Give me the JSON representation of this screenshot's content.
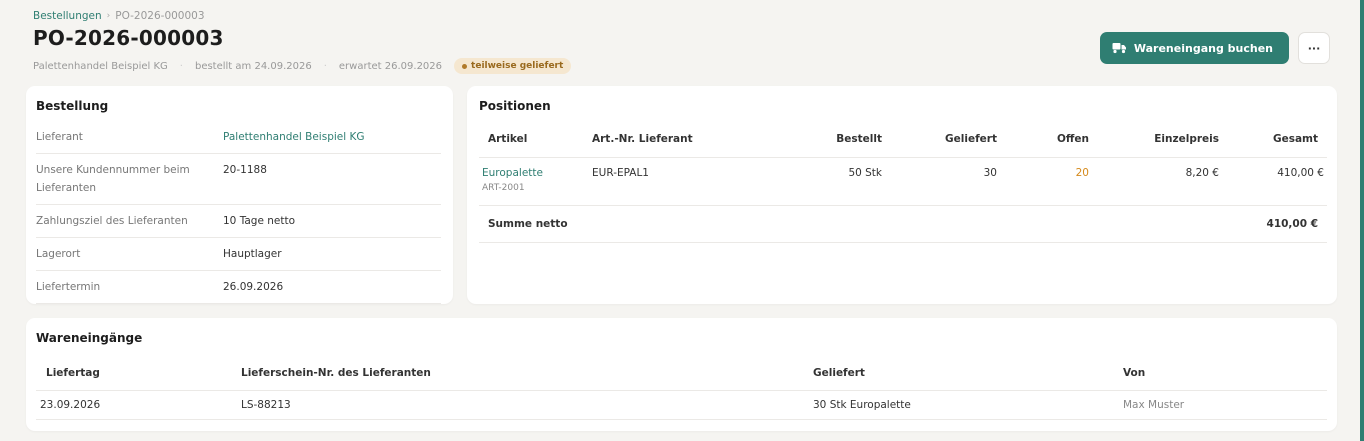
{
  "breadcrumb": {
    "parent": "Bestellungen",
    "separator": "›",
    "current": "PO-2026-000003"
  },
  "page_title": "PO-2026-000003",
  "meta": {
    "supplier": "Palettenhandel Beispiel KG",
    "ordered": "bestellt am 24.09.2026",
    "expected": "erwartet 26.09.2026",
    "status": "teilweise geliefert",
    "dot": "·"
  },
  "actions": {
    "primary_label": "Wareneingang buchen",
    "more_label": "···"
  },
  "colors": {
    "accent": "#2f7e72",
    "open_qty": "#d58a1c",
    "badge_bg": "#f5e7d0"
  },
  "bestellung": {
    "title": "Bestellung",
    "rows": [
      {
        "key": "Lieferant",
        "value": "Palettenhandel Beispiel KG"
      },
      {
        "key": "Unsere Kundennummer beim Lieferanten",
        "value": "20-1188"
      },
      {
        "key": "Zahlungsziel des Lieferanten",
        "value": "10 Tage netto"
      },
      {
        "key": "Lagerort",
        "value": "Hauptlager"
      },
      {
        "key": "Liefertermin",
        "value": "26.09.2026"
      }
    ]
  },
  "positionen": {
    "title": "Positionen",
    "headers": [
      "Artikel",
      "Art.-Nr. Lieferant",
      "Bestellt",
      "Geliefert",
      "Offen",
      "Einzelpreis",
      "Gesamt"
    ],
    "items": [
      {
        "name": "Europalette",
        "sku": "ART-2001",
        "supplier_no": "EUR-EPAL1",
        "ordered": "50 Stk",
        "delivered": "30",
        "open": "20",
        "unit_price": "8,20 €",
        "total": "410,00 €"
      }
    ],
    "sum_label": "Summe netto",
    "sum_value": "410,00 €"
  },
  "wareneingaenge": {
    "title": "Wareneingänge",
    "headers": [
      "Liefertag",
      "Lieferschein-Nr. des Lieferanten",
      "Geliefert",
      "Von"
    ],
    "rows": [
      {
        "date": "23.09.2026",
        "delivery_note": "LS-88213",
        "delivered": "30 Stk Europalette",
        "by": "Max Muster"
      }
    ]
  },
  "icons": {
    "primary_button_icon": "truck-icon"
  }
}
